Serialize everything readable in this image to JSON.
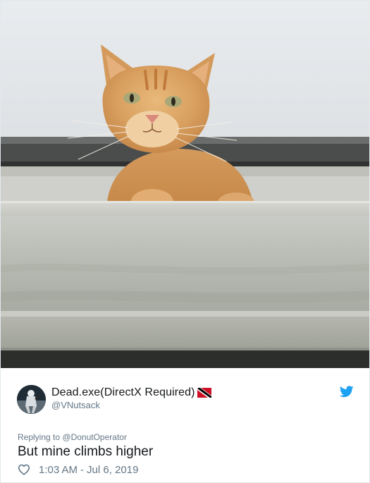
{
  "tweet": {
    "author": {
      "display_name": "Dead.exe(DirectX Required)",
      "handle": "@VNutsack",
      "flag_icon": "trinidad-tobago-flag-icon"
    },
    "reply_context": {
      "prefix": "Replying to",
      "reply_to": "@DonutOperator"
    },
    "text": "But mine climbs higher",
    "time": "1:03 AM",
    "separator": "-",
    "date": "Jul 6, 2019",
    "icons": {
      "brand": "twitter-bird-icon",
      "like": "heart-icon"
    }
  },
  "colors": {
    "primary_text": "#14171a",
    "secondary_text": "#657786",
    "twitter_blue": "#1da1f2",
    "card_border": "#e1e8ed"
  }
}
